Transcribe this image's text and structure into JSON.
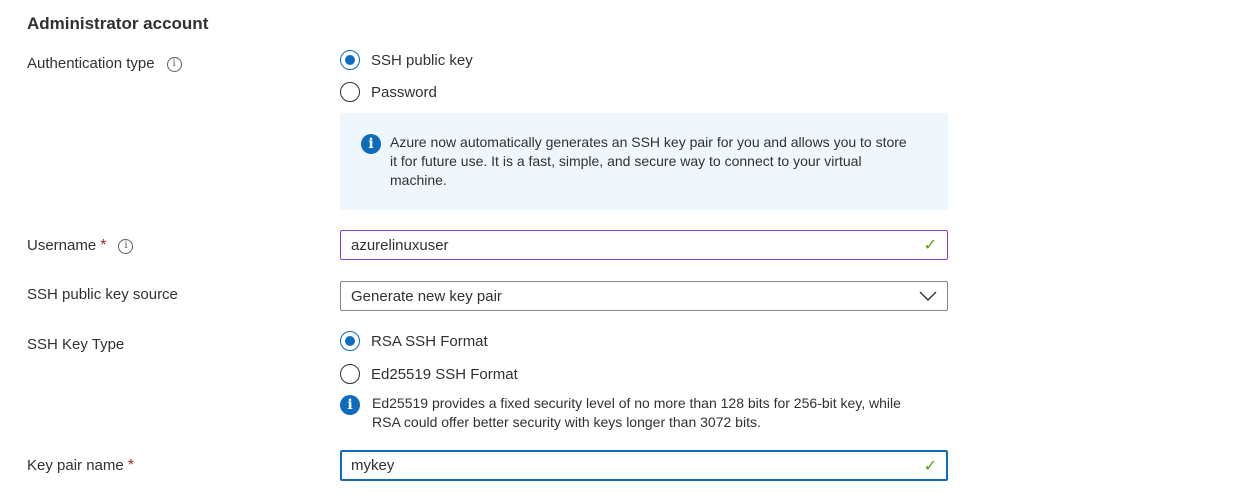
{
  "section_title": "Administrator account",
  "authentication": {
    "label": "Authentication type",
    "options": [
      {
        "label": "SSH public key",
        "checked": true
      },
      {
        "label": "Password",
        "checked": false
      }
    ],
    "info_text": "Azure now automatically generates an SSH key pair for you and allows you to store it for future use. It is a fast, simple, and secure way to connect to your virtual machine."
  },
  "username": {
    "label": "Username",
    "required_mark": "*",
    "value": "azurelinuxuser"
  },
  "key_source": {
    "label": "SSH public key source",
    "value": "Generate new key pair"
  },
  "key_type": {
    "label": "SSH Key Type",
    "options": [
      {
        "label": "RSA SSH Format",
        "checked": true
      },
      {
        "label": "Ed25519 SSH Format",
        "checked": false
      }
    ],
    "note": "Ed25519 provides a fixed security level of no more than 128 bits for 256-bit key, while RSA could offer better security with keys longer than 3072 bits."
  },
  "key_pair_name": {
    "label": "Key pair name",
    "required_mark": "*",
    "value": "mykey"
  },
  "icons": {
    "info": "info-icon",
    "check": "checkmark-icon",
    "chevron": "chevron-down-icon"
  },
  "colors": {
    "accent": "#0f6cbd",
    "info_background": "#eff6fc",
    "valid_check": "#57a300",
    "required": "#a4262c"
  }
}
